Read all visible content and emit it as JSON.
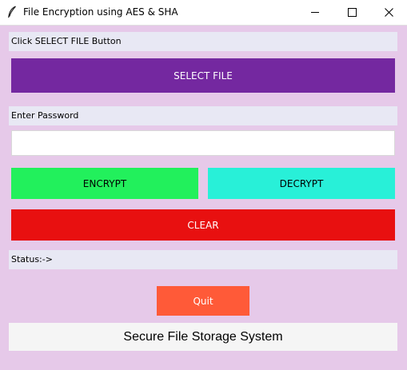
{
  "window": {
    "title": "File Encryption using AES & SHA"
  },
  "select_file": {
    "prompt": "Click SELECT FILE Button",
    "button_label": "SELECT FILE",
    "button_color": "#7428a0"
  },
  "password": {
    "label": "Enter Password",
    "value": ""
  },
  "actions": {
    "encrypt_label": "ENCRYPT",
    "encrypt_color": "#22f05c",
    "decrypt_label": "DECRYPT",
    "decrypt_color": "#28f0d8",
    "clear_label": "CLEAR",
    "clear_color": "#e81010"
  },
  "status": {
    "text": "Status:->"
  },
  "quit": {
    "label": "Quit",
    "color": "#ff5a38"
  },
  "footer": {
    "text": "Secure File Storage System"
  },
  "icons": {
    "app": "feather-icon",
    "minimize": "minimize-icon",
    "maximize": "maximize-icon",
    "close": "close-icon"
  }
}
